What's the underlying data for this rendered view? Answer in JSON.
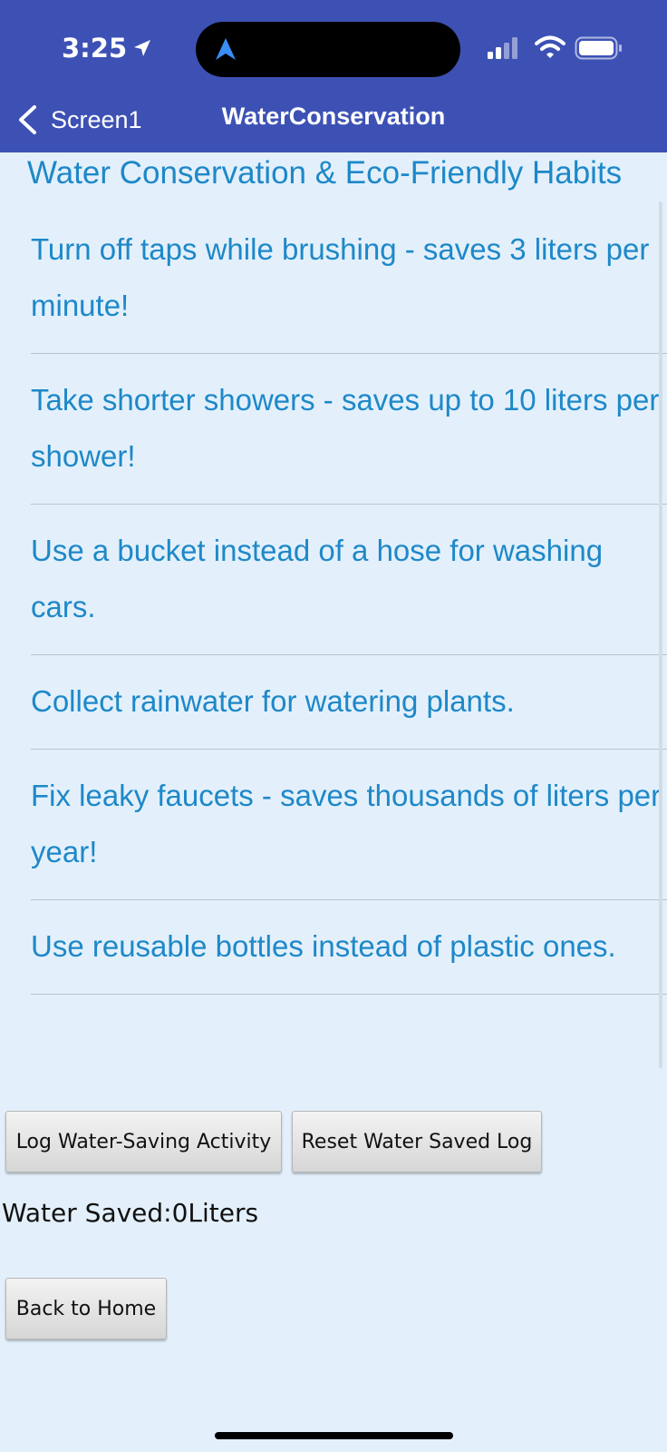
{
  "status_bar": {
    "time": "3:25"
  },
  "nav": {
    "back_label": "Screen1",
    "title": "WaterConservation"
  },
  "page": {
    "heading": "Water Conservation & Eco-Friendly Habits"
  },
  "tips": [
    "Turn off taps while brushing - saves 3 liters per minute!",
    "Take shorter showers - saves up to 10 liters per shower!",
    "Use a bucket instead of a hose for washing cars.",
    "Collect rainwater for watering plants.",
    "Fix leaky faucets - saves thousands of liters per year!",
    "Use reusable bottles instead of plastic ones."
  ],
  "actions": {
    "log_label": "Log Water-Saving Activity",
    "reset_label": "Reset Water Saved Log",
    "home_label": "Back to Home"
  },
  "water_saved": {
    "text": "Water Saved:0Liters"
  },
  "colors": {
    "header_bg": "#3d51b5",
    "page_bg": "#e3f0fb",
    "accent_text": "#1e88c8"
  },
  "icons": {
    "back": "chevron-left-icon",
    "location": "location-arrow-icon",
    "signal": "cellular-signal-icon",
    "wifi": "wifi-icon",
    "battery": "battery-icon"
  }
}
